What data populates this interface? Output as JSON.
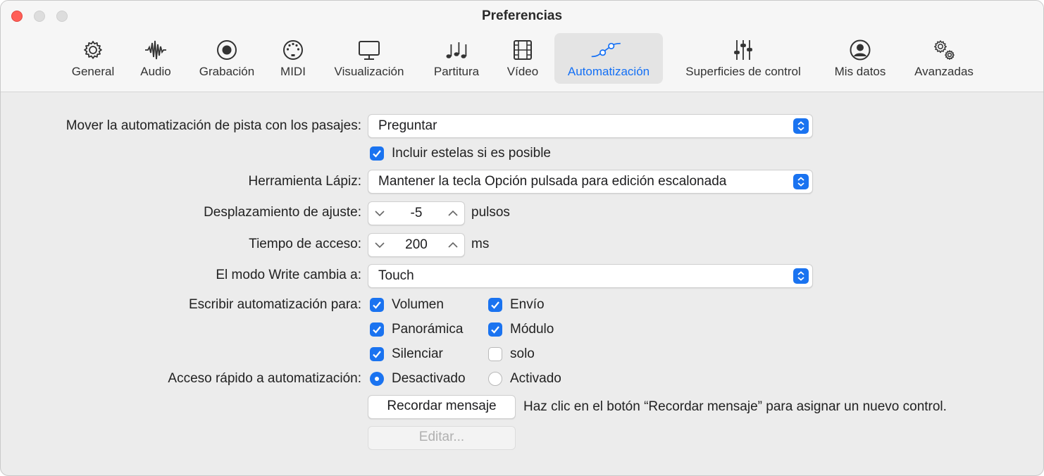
{
  "window": {
    "title": "Preferencias"
  },
  "tabs": [
    {
      "label": "General",
      "icon": "gear-icon",
      "active": false
    },
    {
      "label": "Audio",
      "icon": "waveform-icon",
      "active": false
    },
    {
      "label": "Grabación",
      "icon": "record-icon",
      "active": false
    },
    {
      "label": "MIDI",
      "icon": "midi-connector-icon",
      "active": false
    },
    {
      "label": "Visualización",
      "icon": "monitor-icon",
      "active": false
    },
    {
      "label": "Partitura",
      "icon": "music-notes-icon",
      "active": false
    },
    {
      "label": "Vídeo",
      "icon": "film-icon",
      "active": false
    },
    {
      "label": "Automatización",
      "icon": "automation-curve-icon",
      "active": true
    },
    {
      "label": "Superficies de control",
      "icon": "sliders-icon",
      "active": false
    },
    {
      "label": "Mis datos",
      "icon": "person-icon",
      "active": false
    },
    {
      "label": "Avanzadas",
      "icon": "gears-icon",
      "active": false
    }
  ],
  "settings": {
    "move_automation": {
      "label": "Mover la automatización de pista con los pasajes:",
      "value": "Preguntar"
    },
    "include_trails": {
      "label": "Incluir estelas si es posible",
      "checked": true
    },
    "pencil_tool": {
      "label": "Herramienta Lápiz:",
      "value": "Mantener la tecla Opción pulsada para edición escalonada"
    },
    "snap_offset": {
      "label": "Desplazamiento de ajuste:",
      "value": "-5",
      "unit": "pulsos"
    },
    "ramp_time": {
      "label": "Tiempo de acceso:",
      "value": "200",
      "unit": "ms"
    },
    "write_mode": {
      "label": "El modo Write cambia a:",
      "value": "Touch"
    },
    "write_automation": {
      "label": "Escribir automatización para:",
      "volume": {
        "label": "Volumen",
        "checked": true
      },
      "send": {
        "label": "Envío",
        "checked": true
      },
      "pan": {
        "label": "Panorámica",
        "checked": true
      },
      "plugin": {
        "label": "Módulo",
        "checked": true
      },
      "mute": {
        "label": "Silenciar",
        "checked": true
      },
      "solo": {
        "label": "solo",
        "checked": false
      }
    },
    "quick_access": {
      "label": "Acceso rápido a automatización:",
      "off": {
        "label": "Desactivado",
        "selected": true
      },
      "on": {
        "label": "Activado",
        "selected": false
      }
    },
    "learn_button": {
      "label": "Recordar mensaje"
    },
    "learn_hint": "Haz clic en el botón “Recordar mensaje” para asignar un nuevo control.",
    "edit_button": {
      "label": "Editar..."
    }
  },
  "colors": {
    "accent": "#1a73f0",
    "close": "#ff5f57"
  }
}
